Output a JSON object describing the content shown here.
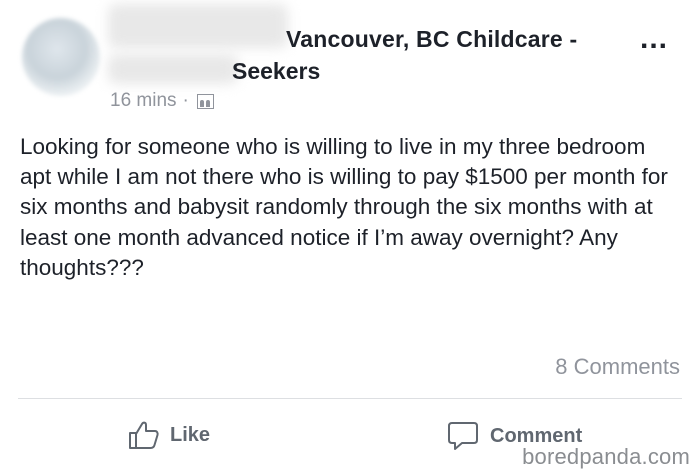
{
  "header": {
    "group_title_line1": "Vancouver, BC Childcare -",
    "group_title_line2": "Seekers",
    "timestamp": "16 mins",
    "separator": "·",
    "more_label": "..."
  },
  "post": {
    "text": "Looking for someone who is willing to live in my three bedroom apt while I am not there who is willing to pay $1500 per month for six months and babysit randomly through the six months with at least one month advanced notice if I’m away overnight? Any thoughts???"
  },
  "stats": {
    "comments_label": "8 Comments"
  },
  "actions": {
    "like_label": "Like",
    "comment_label": "Comment"
  },
  "watermark": "boredpanda.com",
  "colors": {
    "text": "#1d2129",
    "muted": "#90949c",
    "action": "#606770",
    "divider": "#dddfe2"
  }
}
